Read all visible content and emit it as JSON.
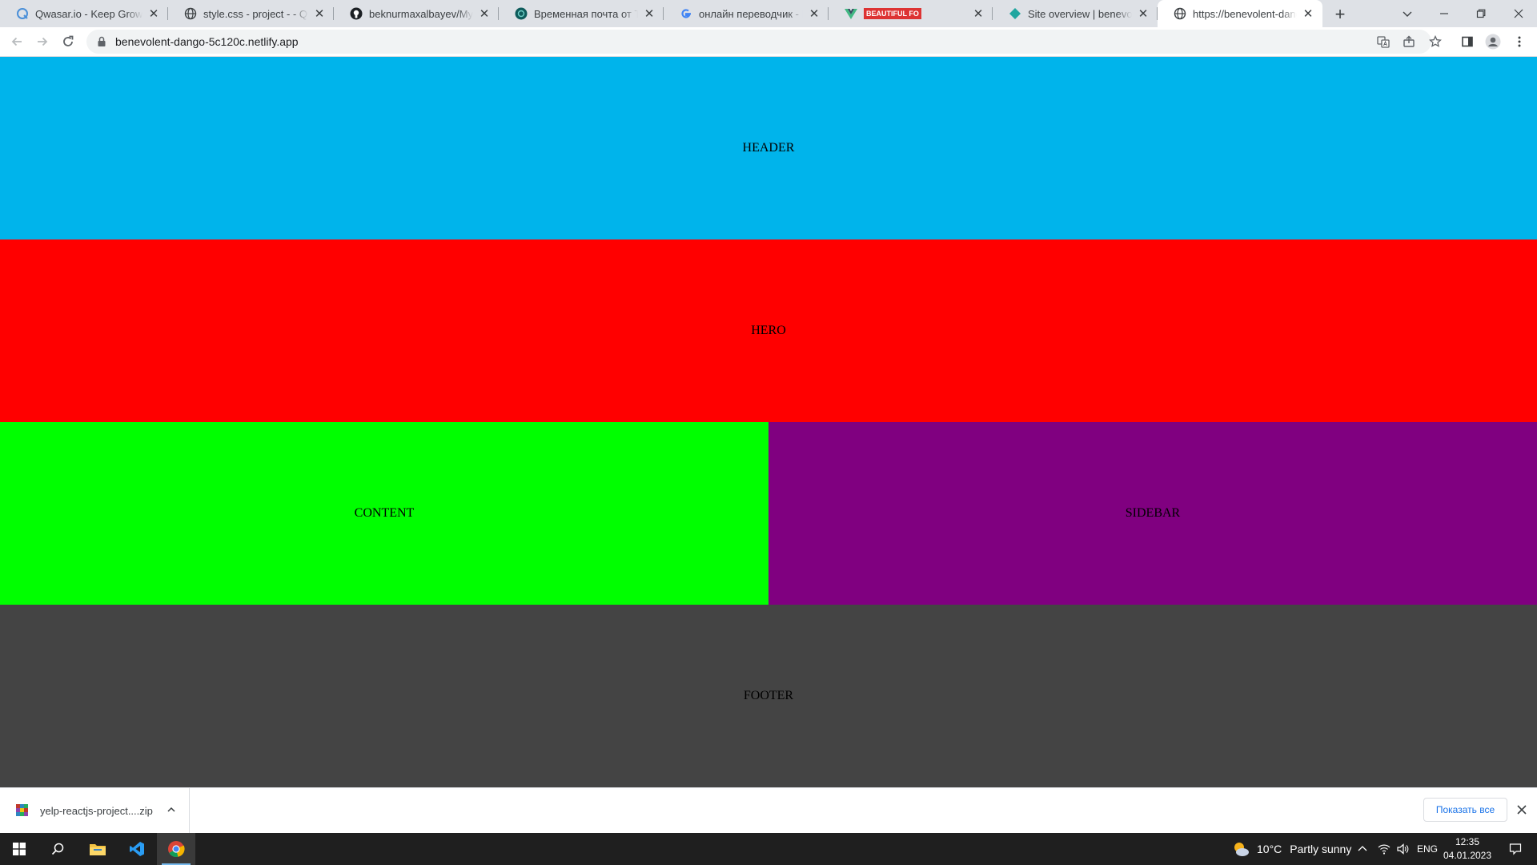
{
  "browser": {
    "tabs": [
      {
        "title": "Qwasar.io - Keep Growing",
        "icon": "qwasar-icon",
        "active": false
      },
      {
        "title": "style.css - project - - Qwasar",
        "icon": "globe-icon",
        "active": false
      },
      {
        "title": "beknurmaxalbayev/My-Css",
        "icon": "github-icon",
        "active": false
      },
      {
        "title": "Временная почта от Temp",
        "icon": "tempmail-icon",
        "active": false
      },
      {
        "title": "онлайн переводчик - Поиск",
        "icon": "google-icon",
        "active": false
      },
      {
        "title": "BEAUTIFUL FO",
        "icon": "vue-icon",
        "active": false
      },
      {
        "title": "Site overview | benevolent",
        "icon": "netlify-icon",
        "active": false
      },
      {
        "title": "https://benevolent-dango",
        "icon": "globe-icon",
        "active": true
      }
    ],
    "address_bar": {
      "url": "benevolent-dango-5c120c.netlify.app"
    }
  },
  "page": {
    "header": {
      "label": "HEADER",
      "color": "#00b4eb"
    },
    "hero": {
      "label": "HERO",
      "color": "#ff0000"
    },
    "content": {
      "label": "CONTENT",
      "color": "#00ff00"
    },
    "sidebar": {
      "label": "SIDEBAR",
      "color": "#800080"
    },
    "footer": {
      "label": "FOOTER",
      "color": "#444444"
    }
  },
  "download_shelf": {
    "file_name": "yelp-reactjs-project....zip",
    "show_all_label": "Показать все"
  },
  "taskbar": {
    "weather": {
      "temperature": "10°C",
      "condition": "Partly sunny"
    },
    "language": "ENG",
    "time": "12:35",
    "date": "04.01.2023"
  }
}
